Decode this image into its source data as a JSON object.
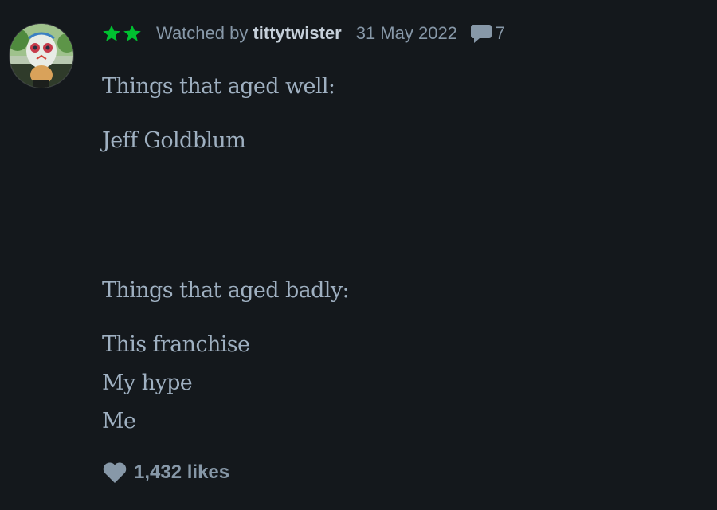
{
  "rating": {
    "stars": 2,
    "color": "#00c030"
  },
  "meta": {
    "watched_prefix": "Watched by ",
    "username": "tittytwister",
    "date": "31 May 2022",
    "comment_count": "7"
  },
  "review": {
    "heading_good": "Things that aged well:",
    "good_items": [
      "Jeff Goldblum"
    ],
    "heading_bad": "Things that aged badly:",
    "bad_items": [
      "This franchise",
      "My hype",
      "Me"
    ]
  },
  "likes": {
    "label": "1,432 likes"
  },
  "icons": {
    "avatar": "avatar-image",
    "star": "star-icon",
    "comment": "speech-bubble-icon",
    "like": "heart-icon"
  },
  "colors": {
    "background": "#14181c",
    "meta_text": "#8798a8",
    "username": "#c6d0da",
    "body_text": "#9fb0c1"
  }
}
